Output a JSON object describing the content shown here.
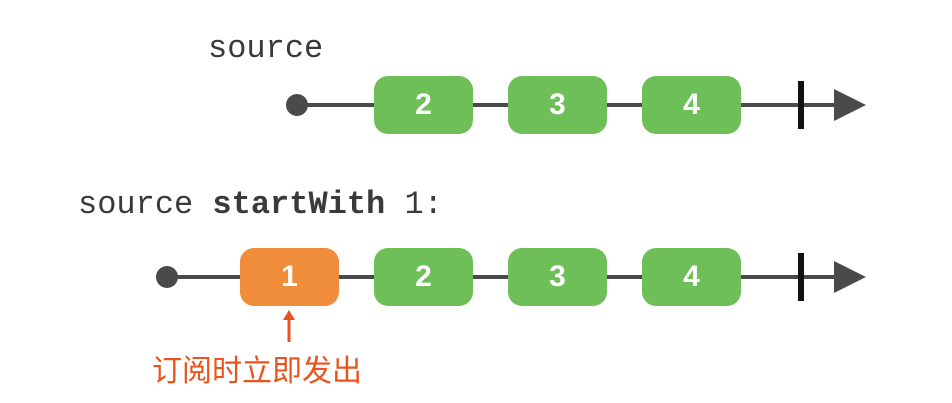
{
  "top": {
    "label": "source",
    "marbles": [
      "2",
      "3",
      "4"
    ]
  },
  "bottom": {
    "label_prefix": "source ",
    "label_operator": "startWith",
    "label_suffix": " 1:",
    "marbles": [
      "1",
      "2",
      "3",
      "4"
    ]
  },
  "note": "订阅时立即发出",
  "colors": {
    "green": "#6fbf59",
    "orange": "#ef8d3a",
    "line": "#4a4a4a",
    "note": "#e8541c"
  }
}
